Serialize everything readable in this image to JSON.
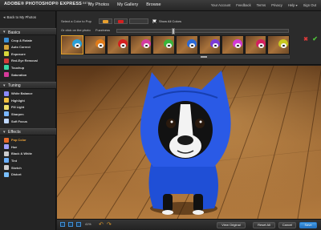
{
  "app": {
    "logo": "ADOBE® PHOTOSHOP® EXPRESS",
    "logo_badge": "BETA"
  },
  "nav": [
    "My Photos",
    "My Gallery",
    "Browse"
  ],
  "top_links": [
    "Your Account",
    "Feedback",
    "Terms",
    "Privacy",
    "Help ▾",
    "Sign Out"
  ],
  "sidebar": {
    "back": "Back to My Photos",
    "sections": [
      {
        "title": "Basics",
        "tools": [
          "Crop & Rotate",
          "Auto Correct",
          "Exposure",
          "Red-Eye Removal",
          "Touchup",
          "Saturation"
        ]
      },
      {
        "title": "Tuning",
        "tools": [
          "White Balance",
          "Highlight",
          "Fill Light",
          "Sharpen",
          "Soft Focus"
        ]
      },
      {
        "title": "Effects",
        "tools": [
          "Pop Color",
          "Hue",
          "Black & White",
          "Tint",
          "Sketch",
          "Distort"
        ]
      }
    ],
    "active_tool": "Pop Color"
  },
  "toolbar": {
    "select_prompt": "Select a Color to Pop",
    "click_prompt": "Or click on the photo",
    "fuzziness_label": "Fuzziness",
    "show_all_label": "Show All Colors",
    "show_all_checked": true,
    "color_options": [
      "#e8a030",
      "#d42020"
    ],
    "fuzziness_value": 0.32,
    "scroll_value": 0.63,
    "hood_colors": [
      "#2aa0d8",
      "#e07b1a",
      "#d42020",
      "#d43aa0",
      "#3ab43a",
      "#2a6ad8",
      "#7a3ad8",
      "#d43ad4",
      "#d42060",
      "#c8c820"
    ],
    "selected_index": 0
  },
  "bottom": {
    "zoom": "41%",
    "buttons": {
      "view_original": "View Original",
      "reset_all": "Reset All",
      "cancel": "Cancel",
      "save": "Save"
    }
  },
  "colors": {
    "accent_active": "#f2a63a",
    "save_blue": "#2a78c4",
    "hood_blue": "#1f4fd6"
  }
}
